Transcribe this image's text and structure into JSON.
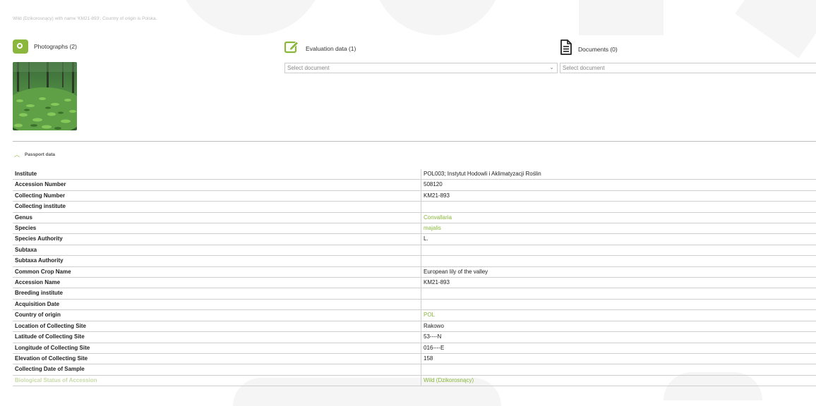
{
  "header": {
    "title": "",
    "subtitle": "Wild (Dzikorosnący) with name 'KM21-893'. Country of origin is Polska."
  },
  "tabs": {
    "photos": {
      "label": "Photographs (2)",
      "icon": "camera-icon"
    },
    "evaluation": {
      "label": "Evaluation data (1)",
      "icon": "edit-icon",
      "select_placeholder": "Select document"
    },
    "documents": {
      "label": "Documents (0)",
      "icon": "document-icon",
      "select_placeholder": "Select document"
    }
  },
  "passport": {
    "title": "Passport data",
    "rows": [
      {
        "key": "Institute",
        "value": "POL003; Instytut Hodowli i Aklimatyzacji Roślin"
      },
      {
        "key": "Accession Number",
        "value": "508120"
      },
      {
        "key": "Collecting Number",
        "value": "KM21-893"
      },
      {
        "key": "Collecting institute",
        "value": ""
      },
      {
        "key": "Genus",
        "value": "Convallaria",
        "link": true
      },
      {
        "key": "Species",
        "value": "majalis",
        "link": true
      },
      {
        "key": "Species Authority",
        "value": "L."
      },
      {
        "key": "Subtaxa",
        "value": ""
      },
      {
        "key": "Subtaxa Authority",
        "value": ""
      },
      {
        "key": "Common Crop Name",
        "value": "European lily of the valley"
      },
      {
        "key": "Accession Name",
        "value": "KM21-893"
      },
      {
        "key": "Breeding institute",
        "value": ""
      },
      {
        "key": "Acquisition Date",
        "value": ""
      },
      {
        "key": "Country of origin",
        "value": "POL",
        "link": true
      },
      {
        "key": "Location of Collecting Site",
        "value": "Rakowo"
      },
      {
        "key": "Latitude of Collecting Site",
        "value": "53----N"
      },
      {
        "key": "Longitude of Collecting Site",
        "value": "016----E"
      },
      {
        "key": "Elevation of Collecting Site",
        "value": "158"
      },
      {
        "key": "Collecting Date of Sample",
        "value": ""
      },
      {
        "key": "Biological Status of Accession",
        "value": "Wild (Dzikorosnący)",
        "link": true,
        "faded": true
      }
    ]
  },
  "colors": {
    "accent": "#8ab73c",
    "border": "#cfcfcf"
  }
}
